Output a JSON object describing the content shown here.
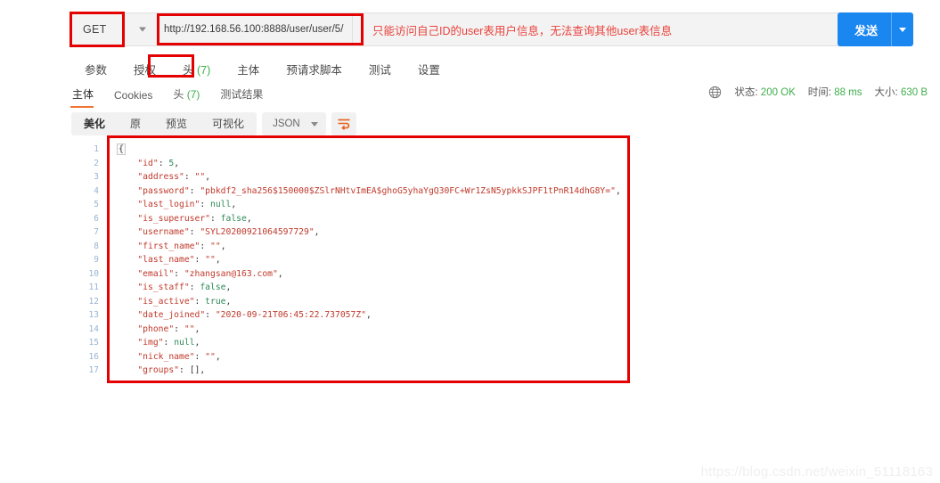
{
  "request": {
    "method": "GET",
    "url": "http://192.168.56.100:8888/user/user/5/",
    "annotation": "只能访问自己ID的user表用户信息，无法查询其他user表信息",
    "send_label": "发送"
  },
  "request_tabs": [
    {
      "label": "参数",
      "count": ""
    },
    {
      "label": "授权",
      "count": ""
    },
    {
      "label": "头",
      "count": "(7)"
    },
    {
      "label": "主体",
      "count": ""
    },
    {
      "label": "预请求脚本",
      "count": ""
    },
    {
      "label": "测试",
      "count": ""
    },
    {
      "label": "设置",
      "count": ""
    }
  ],
  "response_tabs": [
    {
      "label": "主体",
      "count": ""
    },
    {
      "label": "Cookies",
      "count": ""
    },
    {
      "label": "头",
      "count": "(7)"
    },
    {
      "label": "测试结果",
      "count": ""
    }
  ],
  "status": {
    "state_label": "状态:",
    "state_value": "200 OK",
    "time_label": "时间:",
    "time_value": "88 ms",
    "size_label": "大小:",
    "size_value": "630 B"
  },
  "format_bar": {
    "buttons": [
      "美化",
      "原",
      "预览",
      "可视化"
    ],
    "select_value": "JSON",
    "wrap_icon": "word-wrap-icon"
  },
  "body": {
    "line_numbers": [
      "1",
      "2",
      "3",
      "4",
      "5",
      "6",
      "7",
      "8",
      "9",
      "10",
      "11",
      "12",
      "13",
      "14",
      "15",
      "16",
      "17"
    ],
    "json": {
      "id": 5,
      "address": "",
      "password": "pbkdf2_sha256$150000$ZSlrNHtvImEA$ghoG5yhaYgQ30FC+Wr1ZsN5ypkkSJPF1tPnR14dhG8Y=",
      "last_login": null,
      "is_superuser": false,
      "username": "SYL20200921064597729",
      "first_name": "",
      "last_name": "",
      "email": "zhangsan@163.com",
      "is_staff": false,
      "is_active": true,
      "date_joined": "2020-09-21T06:45:22.737057Z",
      "phone": "",
      "img": null,
      "nick_name": "",
      "groups": []
    },
    "lines": [
      {
        "indent": 0,
        "parts": [
          {
            "t": "{",
            "c": "brace"
          }
        ]
      },
      {
        "indent": 1,
        "parts": [
          {
            "t": "\"id\"",
            "c": "key"
          },
          {
            "t": ": ",
            "c": "pun"
          },
          {
            "t": "5",
            "c": "num"
          },
          {
            "t": ",",
            "c": "pun"
          }
        ]
      },
      {
        "indent": 1,
        "parts": [
          {
            "t": "\"address\"",
            "c": "key"
          },
          {
            "t": ": ",
            "c": "pun"
          },
          {
            "t": "\"\"",
            "c": "str"
          },
          {
            "t": ",",
            "c": "pun"
          }
        ]
      },
      {
        "indent": 1,
        "parts": [
          {
            "t": "\"password\"",
            "c": "key"
          },
          {
            "t": ": ",
            "c": "pun"
          },
          {
            "t": "\"pbkdf2_sha256$150000$ZSlrNHtvImEA$ghoG5yhaYgQ30FC+Wr1ZsN5ypkkSJPF1tPnR14dhG8Y=\"",
            "c": "str"
          },
          {
            "t": ",",
            "c": "pun"
          }
        ]
      },
      {
        "indent": 1,
        "parts": [
          {
            "t": "\"last_login\"",
            "c": "key"
          },
          {
            "t": ": ",
            "c": "pun"
          },
          {
            "t": "null",
            "c": "null"
          },
          {
            "t": ",",
            "c": "pun"
          }
        ]
      },
      {
        "indent": 1,
        "parts": [
          {
            "t": "\"is_superuser\"",
            "c": "key"
          },
          {
            "t": ": ",
            "c": "pun"
          },
          {
            "t": "false",
            "c": "bool"
          },
          {
            "t": ",",
            "c": "pun"
          }
        ]
      },
      {
        "indent": 1,
        "parts": [
          {
            "t": "\"username\"",
            "c": "key"
          },
          {
            "t": ": ",
            "c": "pun"
          },
          {
            "t": "\"SYL20200921064597729\"",
            "c": "str"
          },
          {
            "t": ",",
            "c": "pun"
          }
        ]
      },
      {
        "indent": 1,
        "parts": [
          {
            "t": "\"first_name\"",
            "c": "key"
          },
          {
            "t": ": ",
            "c": "pun"
          },
          {
            "t": "\"\"",
            "c": "str"
          },
          {
            "t": ",",
            "c": "pun"
          }
        ]
      },
      {
        "indent": 1,
        "parts": [
          {
            "t": "\"last_name\"",
            "c": "key"
          },
          {
            "t": ": ",
            "c": "pun"
          },
          {
            "t": "\"\"",
            "c": "str"
          },
          {
            "t": ",",
            "c": "pun"
          }
        ]
      },
      {
        "indent": 1,
        "parts": [
          {
            "t": "\"email\"",
            "c": "key"
          },
          {
            "t": ": ",
            "c": "pun"
          },
          {
            "t": "\"zhangsan@163.com\"",
            "c": "str"
          },
          {
            "t": ",",
            "c": "pun"
          }
        ]
      },
      {
        "indent": 1,
        "parts": [
          {
            "t": "\"is_staff\"",
            "c": "key"
          },
          {
            "t": ": ",
            "c": "pun"
          },
          {
            "t": "false",
            "c": "bool"
          },
          {
            "t": ",",
            "c": "pun"
          }
        ]
      },
      {
        "indent": 1,
        "parts": [
          {
            "t": "\"is_active\"",
            "c": "key"
          },
          {
            "t": ": ",
            "c": "pun"
          },
          {
            "t": "true",
            "c": "bool"
          },
          {
            "t": ",",
            "c": "pun"
          }
        ]
      },
      {
        "indent": 1,
        "parts": [
          {
            "t": "\"date_joined\"",
            "c": "key"
          },
          {
            "t": ": ",
            "c": "pun"
          },
          {
            "t": "\"2020-09-21T06:45:22.737057Z\"",
            "c": "str"
          },
          {
            "t": ",",
            "c": "pun"
          }
        ]
      },
      {
        "indent": 1,
        "parts": [
          {
            "t": "\"phone\"",
            "c": "key"
          },
          {
            "t": ": ",
            "c": "pun"
          },
          {
            "t": "\"\"",
            "c": "str"
          },
          {
            "t": ",",
            "c": "pun"
          }
        ]
      },
      {
        "indent": 1,
        "parts": [
          {
            "t": "\"img\"",
            "c": "key"
          },
          {
            "t": ": ",
            "c": "pun"
          },
          {
            "t": "null",
            "c": "null"
          },
          {
            "t": ",",
            "c": "pun"
          }
        ]
      },
      {
        "indent": 1,
        "parts": [
          {
            "t": "\"nick_name\"",
            "c": "key"
          },
          {
            "t": ": ",
            "c": "pun"
          },
          {
            "t": "\"\"",
            "c": "str"
          },
          {
            "t": ",",
            "c": "pun"
          }
        ]
      },
      {
        "indent": 1,
        "parts": [
          {
            "t": "\"groups\"",
            "c": "key"
          },
          {
            "t": ": ",
            "c": "pun"
          },
          {
            "t": "[]",
            "c": "pun"
          },
          {
            "t": ",",
            "c": "pun"
          }
        ]
      }
    ]
  },
  "watermark": "https://blog.csdn.net/weixin_51118163",
  "colors": {
    "accent_blue": "#1a86f0",
    "annotation_red": "#e8433c",
    "highlight_red": "#e40000",
    "success_green": "#3fae4b",
    "tab_underline": "#f07632"
  }
}
